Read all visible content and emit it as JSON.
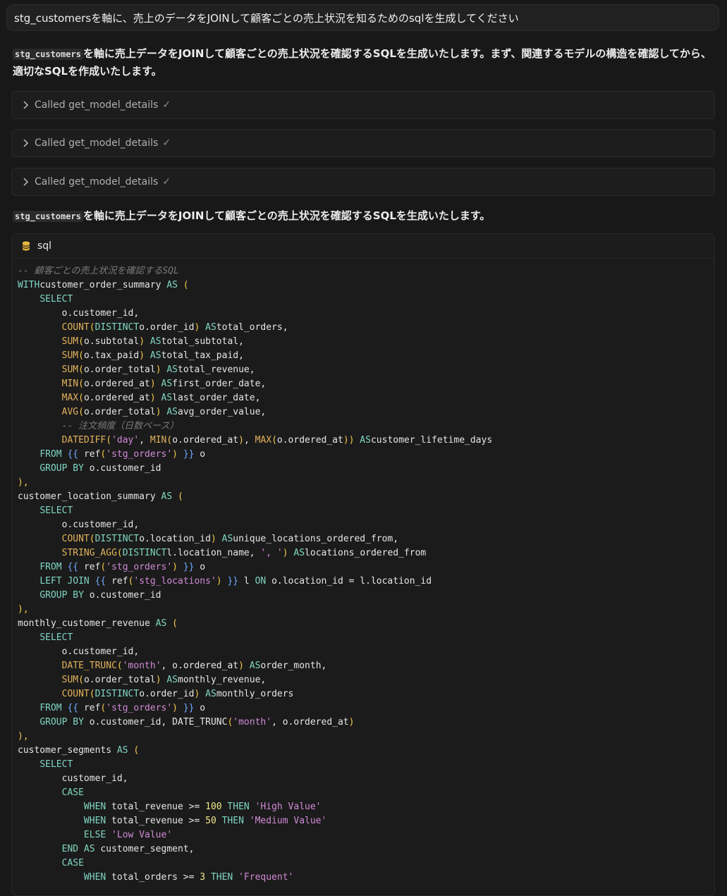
{
  "user_message": "stg_customersを軸に、売上のデータをJOINして顧客ごとの売上状況を知るためのsqlを生成してください",
  "response_1": {
    "code": "stg_customers",
    "text": "を軸に売上データをJOINして顧客ごとの売上状況を確認するSQLを生成いたします。まず、関連するモデルの構造を確認してから、適切なSQLを作成いたします。"
  },
  "tool_calls": [
    {
      "label": "Called get_model_details",
      "status_icon": "check-icon"
    },
    {
      "label": "Called get_model_details",
      "status_icon": "check-icon"
    },
    {
      "label": "Called get_model_details",
      "status_icon": "check-icon"
    }
  ],
  "response_2": {
    "code": "stg_customers",
    "text": "を軸に売上データをJOINして顧客ごとの売上状況を確認するSQLを生成いたします。"
  },
  "code_block": {
    "language": "sql",
    "lines": [
      [
        [
          "cm",
          "-- 顧客ごとの売上状況を確認するSQL"
        ]
      ],
      [
        [
          "kw",
          "WITH"
        ],
        [
          "",
          "customer_order_summary "
        ],
        [
          "kw",
          "AS"
        ],
        [
          "br",
          " ("
        ]
      ],
      [
        [
          "",
          "    "
        ],
        [
          "kw",
          "SELECT"
        ]
      ],
      [
        [
          "",
          "        o.customer_id,"
        ]
      ],
      [
        [
          "",
          "        "
        ],
        [
          "fn",
          "COUNT"
        ],
        [
          "br",
          "("
        ],
        [
          "kw",
          "DISTINCT"
        ],
        [
          "",
          "o.order_id"
        ],
        [
          "br",
          ")"
        ],
        [
          "kw",
          " AS"
        ],
        [
          "",
          "total_orders,"
        ]
      ],
      [
        [
          "",
          "        "
        ],
        [
          "fn",
          "SUM"
        ],
        [
          "br",
          "("
        ],
        [
          "",
          "o.subtotal"
        ],
        [
          "br",
          ")"
        ],
        [
          "kw",
          " AS"
        ],
        [
          "",
          "total_subtotal,"
        ]
      ],
      [
        [
          "",
          "        "
        ],
        [
          "fn",
          "SUM"
        ],
        [
          "br",
          "("
        ],
        [
          "",
          "o.tax_paid"
        ],
        [
          "br",
          ")"
        ],
        [
          "kw",
          " AS"
        ],
        [
          "",
          "total_tax_paid,"
        ]
      ],
      [
        [
          "",
          "        "
        ],
        [
          "fn",
          "SUM"
        ],
        [
          "br",
          "("
        ],
        [
          "",
          "o.order_total"
        ],
        [
          "br",
          ")"
        ],
        [
          "kw",
          " AS"
        ],
        [
          "",
          "total_revenue,"
        ]
      ],
      [
        [
          "",
          "        "
        ],
        [
          "fn",
          "MIN"
        ],
        [
          "br",
          "("
        ],
        [
          "",
          "o.ordered_at"
        ],
        [
          "br",
          ")"
        ],
        [
          "kw",
          " AS"
        ],
        [
          "",
          "first_order_date,"
        ]
      ],
      [
        [
          "",
          "        "
        ],
        [
          "fn",
          "MAX"
        ],
        [
          "br",
          "("
        ],
        [
          "",
          "o.ordered_at"
        ],
        [
          "br",
          ")"
        ],
        [
          "kw",
          " AS"
        ],
        [
          "",
          "last_order_date,"
        ]
      ],
      [
        [
          "",
          "        "
        ],
        [
          "fn",
          "AVG"
        ],
        [
          "br",
          "("
        ],
        [
          "",
          "o.order_total"
        ],
        [
          "br",
          ")"
        ],
        [
          "kw",
          " AS"
        ],
        [
          "",
          "avg_order_value,"
        ]
      ],
      [
        [
          "",
          "        "
        ],
        [
          "cm",
          "-- 注文頻度（日数ベース）"
        ]
      ],
      [
        [
          "",
          "        "
        ],
        [
          "fn",
          "DATEDIFF"
        ],
        [
          "br",
          "("
        ],
        [
          "str",
          "'day'"
        ],
        [
          "",
          ", "
        ],
        [
          "fn",
          "MIN"
        ],
        [
          "br",
          "("
        ],
        [
          "",
          "o.ordered_at"
        ],
        [
          "br",
          ")"
        ],
        [
          "",
          ", "
        ],
        [
          "fn",
          "MAX"
        ],
        [
          "br",
          "("
        ],
        [
          "",
          "o.ordered_at"
        ],
        [
          "br",
          "))"
        ],
        [
          "kw",
          " AS"
        ],
        [
          "",
          "customer_lifetime_days"
        ]
      ],
      [
        [
          "",
          "    "
        ],
        [
          "kw",
          "FROM"
        ],
        [
          "jn",
          " {{ "
        ],
        [
          "",
          "ref"
        ],
        [
          "br",
          "("
        ],
        [
          "str",
          "'stg_orders'"
        ],
        [
          "br",
          ")"
        ],
        [
          "jn",
          " }}"
        ],
        [
          "",
          " o"
        ]
      ],
      [
        [
          "",
          "    "
        ],
        [
          "kw",
          "GROUP BY"
        ],
        [
          "",
          " o.customer_id"
        ]
      ],
      [
        [
          "br",
          "),"
        ]
      ],
      [
        [
          "",
          "customer_location_summary "
        ],
        [
          "kw",
          "AS"
        ],
        [
          "br",
          " ("
        ]
      ],
      [
        [
          "",
          "    "
        ],
        [
          "kw",
          "SELECT"
        ]
      ],
      [
        [
          "",
          "        o.customer_id,"
        ]
      ],
      [
        [
          "",
          "        "
        ],
        [
          "fn",
          "COUNT"
        ],
        [
          "br",
          "("
        ],
        [
          "kw",
          "DISTINCT"
        ],
        [
          "",
          "o.location_id"
        ],
        [
          "br",
          ")"
        ],
        [
          "kw",
          " AS"
        ],
        [
          "",
          "unique_locations_ordered_from,"
        ]
      ],
      [
        [
          "",
          "        "
        ],
        [
          "fn",
          "STRING_AGG"
        ],
        [
          "br",
          "("
        ],
        [
          "kw",
          "DISTINCT"
        ],
        [
          "",
          "l.location_name, "
        ],
        [
          "str",
          "', '"
        ],
        [
          "br",
          ")"
        ],
        [
          "kw",
          " AS"
        ],
        [
          "",
          "locations_ordered_from"
        ]
      ],
      [
        [
          "",
          "    "
        ],
        [
          "kw",
          "FROM"
        ],
        [
          "jn",
          " {{ "
        ],
        [
          "",
          "ref"
        ],
        [
          "br",
          "("
        ],
        [
          "str",
          "'stg_orders'"
        ],
        [
          "br",
          ")"
        ],
        [
          "jn",
          " }}"
        ],
        [
          "",
          " o"
        ]
      ],
      [
        [
          "",
          "    "
        ],
        [
          "kw",
          "LEFT JOIN"
        ],
        [
          "jn",
          " {{ "
        ],
        [
          "",
          "ref"
        ],
        [
          "br",
          "("
        ],
        [
          "str",
          "'stg_locations'"
        ],
        [
          "br",
          ")"
        ],
        [
          "jn",
          " }}"
        ],
        [
          "",
          " l "
        ],
        [
          "kw",
          "ON"
        ],
        [
          "",
          " o.location_id = l.location_id"
        ]
      ],
      [
        [
          "",
          "    "
        ],
        [
          "kw",
          "GROUP BY"
        ],
        [
          "",
          " o.customer_id"
        ]
      ],
      [
        [
          "br",
          "),"
        ]
      ],
      [
        [
          "",
          "monthly_customer_revenue "
        ],
        [
          "kw",
          "AS"
        ],
        [
          "br",
          " ("
        ]
      ],
      [
        [
          "",
          "    "
        ],
        [
          "kw",
          "SELECT"
        ]
      ],
      [
        [
          "",
          "        o.customer_id,"
        ]
      ],
      [
        [
          "",
          "        "
        ],
        [
          "fn",
          "DATE_TRUNC"
        ],
        [
          "br",
          "("
        ],
        [
          "str",
          "'month'"
        ],
        [
          "",
          ", o.ordered_at"
        ],
        [
          "br",
          ")"
        ],
        [
          "kw",
          " AS"
        ],
        [
          "",
          "order_month,"
        ]
      ],
      [
        [
          "",
          "        "
        ],
        [
          "fn",
          "SUM"
        ],
        [
          "br",
          "("
        ],
        [
          "",
          "o.order_total"
        ],
        [
          "br",
          ")"
        ],
        [
          "kw",
          " AS"
        ],
        [
          "",
          "monthly_revenue,"
        ]
      ],
      [
        [
          "",
          "        "
        ],
        [
          "fn",
          "COUNT"
        ],
        [
          "br",
          "("
        ],
        [
          "kw",
          "DISTINCT"
        ],
        [
          "",
          "o.order_id"
        ],
        [
          "br",
          ")"
        ],
        [
          "kw",
          " AS"
        ],
        [
          "",
          "monthly_orders"
        ]
      ],
      [
        [
          "",
          "    "
        ],
        [
          "kw",
          "FROM"
        ],
        [
          "jn",
          " {{ "
        ],
        [
          "",
          "ref"
        ],
        [
          "br",
          "("
        ],
        [
          "str",
          "'stg_orders'"
        ],
        [
          "br",
          ")"
        ],
        [
          "jn",
          " }}"
        ],
        [
          "",
          " o"
        ]
      ],
      [
        [
          "",
          "    "
        ],
        [
          "kw",
          "GROUP BY"
        ],
        [
          "",
          " o.customer_id, DATE_TRUNC"
        ],
        [
          "br",
          "("
        ],
        [
          "str",
          "'month'"
        ],
        [
          "",
          ", o.ordered_at"
        ],
        [
          "br",
          ")"
        ]
      ],
      [
        [
          "br",
          "),"
        ]
      ],
      [
        [
          "",
          "customer_segments "
        ],
        [
          "kw",
          "AS"
        ],
        [
          "br",
          " ("
        ]
      ],
      [
        [
          "",
          "    "
        ],
        [
          "kw",
          "SELECT"
        ]
      ],
      [
        [
          "",
          "        customer_id,"
        ]
      ],
      [
        [
          "",
          "        "
        ],
        [
          "kw",
          "CASE"
        ]
      ],
      [
        [
          "",
          "            "
        ],
        [
          "kw",
          "WHEN"
        ],
        [
          "",
          " total_revenue >= "
        ],
        [
          "num",
          "100"
        ],
        [
          "kw",
          " THEN"
        ],
        [
          "str",
          " 'High Value'"
        ]
      ],
      [
        [
          "",
          "            "
        ],
        [
          "kw",
          "WHEN"
        ],
        [
          "",
          " total_revenue >= "
        ],
        [
          "num",
          "50"
        ],
        [
          "kw",
          " THEN"
        ],
        [
          "str",
          " 'Medium Value'"
        ]
      ],
      [
        [
          "",
          "            "
        ],
        [
          "kw",
          "ELSE"
        ],
        [
          "str",
          " 'Low Value'"
        ]
      ],
      [
        [
          "",
          "        "
        ],
        [
          "kw",
          "END"
        ],
        [
          "kw",
          " AS"
        ],
        [
          "",
          " customer_segment,"
        ]
      ],
      [
        [
          "",
          "        "
        ],
        [
          "kw",
          "CASE"
        ]
      ],
      [
        [
          "",
          "            "
        ],
        [
          "kw",
          "WHEN"
        ],
        [
          "",
          " total_orders >= "
        ],
        [
          "num",
          "3"
        ],
        [
          "kw",
          " THEN"
        ],
        [
          "str",
          " 'Frequent'"
        ]
      ]
    ]
  }
}
